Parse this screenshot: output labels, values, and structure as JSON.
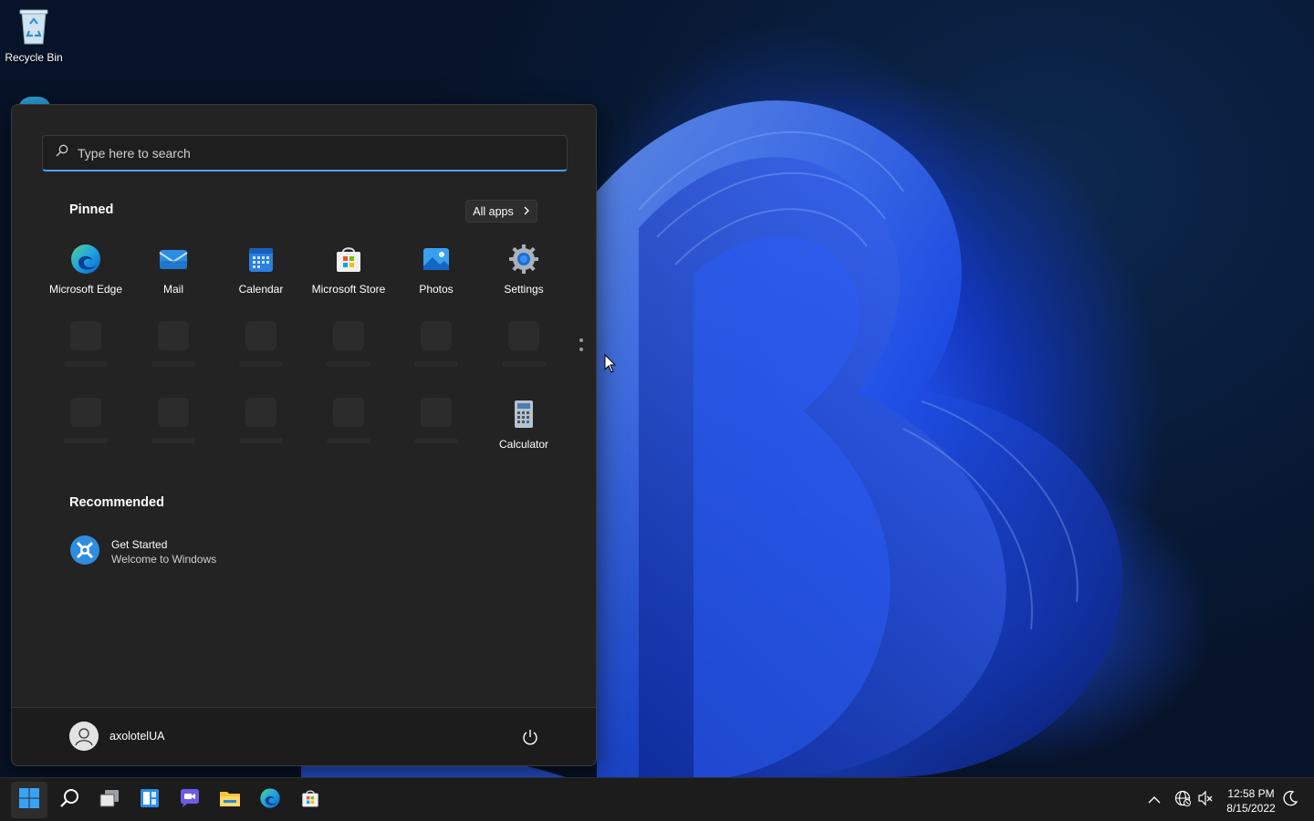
{
  "desktop": {
    "icons": [
      {
        "label": "Recycle Bin",
        "icon": "recycle-bin-icon"
      }
    ]
  },
  "start_menu": {
    "search": {
      "placeholder": "Type here to search",
      "value": ""
    },
    "pinned": {
      "title": "Pinned",
      "all_apps_label": "All apps",
      "apps": [
        {
          "label": "Microsoft Edge",
          "icon": "edge-icon"
        },
        {
          "label": "Mail",
          "icon": "mail-icon"
        },
        {
          "label": "Calendar",
          "icon": "calendar-icon"
        },
        {
          "label": "Microsoft Store",
          "icon": "store-icon"
        },
        {
          "label": "Photos",
          "icon": "photos-icon"
        },
        {
          "label": "Settings",
          "icon": "settings-icon"
        },
        {
          "label": "Calculator",
          "icon": "calculator-icon"
        }
      ]
    },
    "recommended": {
      "title": "Recommended",
      "items": [
        {
          "title": "Get Started",
          "subtitle": "Welcome to Windows",
          "icon": "get-started-icon"
        }
      ]
    },
    "user": {
      "name": "axolotelUA",
      "icon": "user-avatar-icon"
    },
    "power_icon": "power-icon"
  },
  "taskbar": {
    "apps": [
      {
        "name": "Start",
        "icon": "windows-start-icon"
      },
      {
        "name": "Search",
        "icon": "search-icon"
      },
      {
        "name": "Task View",
        "icon": "task-view-icon"
      },
      {
        "name": "Widgets",
        "icon": "widgets-icon"
      },
      {
        "name": "Chat",
        "icon": "chat-icon"
      },
      {
        "name": "File Explorer",
        "icon": "file-explorer-icon"
      },
      {
        "name": "Microsoft Edge",
        "icon": "edge-icon"
      },
      {
        "name": "Microsoft Store",
        "icon": "store-icon"
      }
    ],
    "tray": {
      "icons": [
        "chevron-up-icon",
        "network-icon",
        "volume-muted-icon",
        "notification-icon"
      ],
      "time": "12:58 PM",
      "date": "8/15/2022"
    }
  },
  "colors": {
    "accent": "#4fa0e8",
    "start_bg": "#232323",
    "taskbar_bg": "#1c1c1c"
  }
}
